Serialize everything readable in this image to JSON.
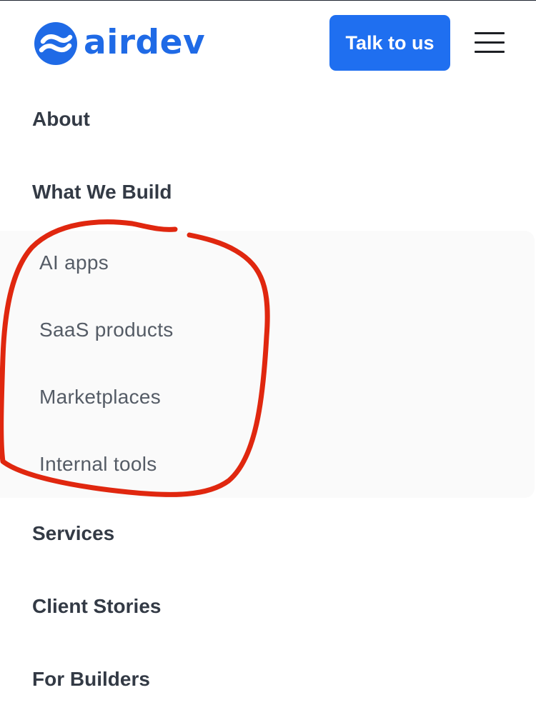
{
  "header": {
    "logo_text": "airdev",
    "cta_label": "Talk to us",
    "menu_icon": "hamburger-menu-icon"
  },
  "nav": {
    "about": "About",
    "what_we_build": "What We Build",
    "submenu": [
      "AI apps",
      "SaaS products",
      "Marketplaces",
      "Internal tools"
    ],
    "services": "Services",
    "client_stories": "Client Stories",
    "for_builders": "For Builders"
  },
  "colors": {
    "brand_blue": "#1f6ff0",
    "nav_text": "#333a45",
    "sub_text": "#555c66",
    "annotation_red": "#e0270f"
  }
}
